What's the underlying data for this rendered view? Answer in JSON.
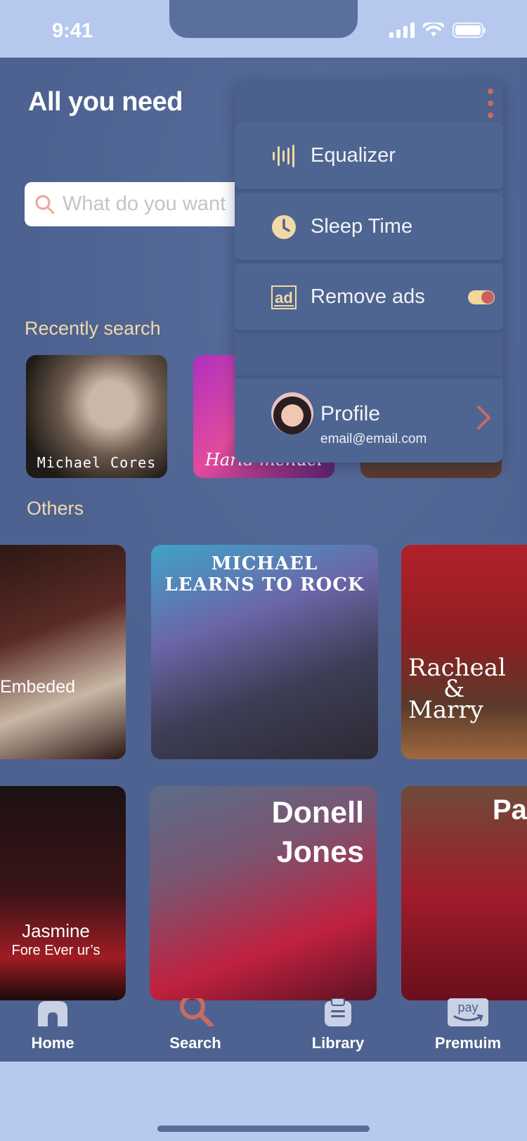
{
  "status_bar": {
    "time": "9:41"
  },
  "header": {
    "title": "All you need"
  },
  "search": {
    "placeholder": "What do you want"
  },
  "sections": {
    "recent": "Recently search",
    "others": "Others"
  },
  "recent_cards": [
    {
      "label": "Michael Cores"
    },
    {
      "label": "Harld menuel"
    },
    {
      "label": ""
    }
  ],
  "other_cards": [
    {
      "label": "Embeded"
    },
    {
      "label_line1": "MICHAEL",
      "label_line2": "LEARNS TO ROCK"
    },
    {
      "label_line1": "Racheal",
      "label_line2": "&",
      "label_line3": "Marry"
    },
    {
      "label_line1": "Jasmine",
      "label_line2": "Fore Ever ur’s"
    },
    {
      "label_line1": "Donell",
      "label_line2": "Jones"
    },
    {
      "label": "Pa"
    }
  ],
  "menu": {
    "items": [
      {
        "label": "Equalizer",
        "icon": "equalizer-icon"
      },
      {
        "label": "Sleep Time",
        "icon": "clock-icon"
      },
      {
        "label": "Remove ads",
        "icon": "ad-icon",
        "toggle_on": true
      }
    ],
    "profile": {
      "name": "Profile",
      "email": "email@email.com"
    }
  },
  "tabs": [
    {
      "label": "Home",
      "icon": "home-icon",
      "active": false
    },
    {
      "label": "Search",
      "icon": "search-icon",
      "active": true
    },
    {
      "label": "Library",
      "icon": "clipboard-icon",
      "active": false
    },
    {
      "label": "Premuim",
      "icon": "amazon-pay-icon",
      "active": false
    }
  ],
  "colors": {
    "background": "#4d6290",
    "accent": "#c86a63",
    "section_label": "#f1d9a8",
    "icon_gold": "#f1d9a8"
  }
}
